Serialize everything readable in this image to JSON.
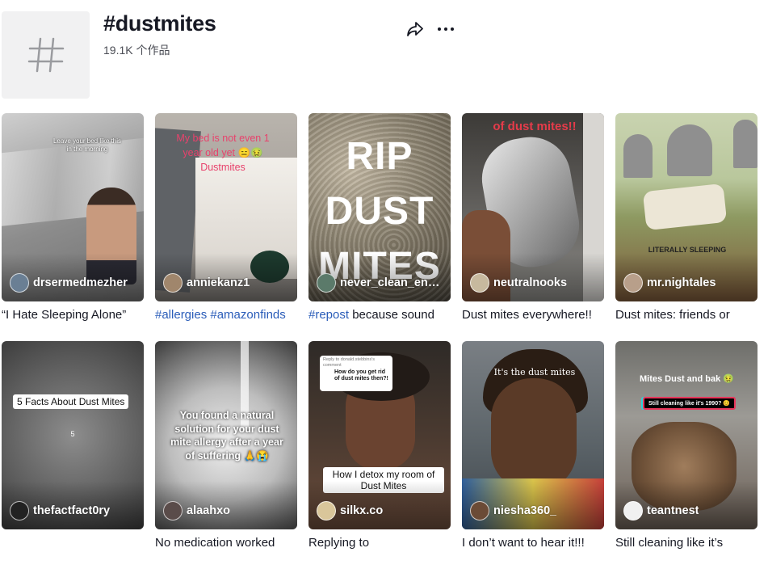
{
  "hashtag": {
    "title": "#dustmites",
    "count": "19.1K 个作品",
    "icon": "hashtag-icon"
  },
  "actions": {
    "share_icon": "share-icon",
    "more_icon": "more-icon"
  },
  "videos": [
    {
      "author": "drsermedmezher",
      "caption": "“I Hate Sleeping Alone”",
      "overlay": "Leave your bed like this in the morning"
    },
    {
      "author": "anniekanz1",
      "caption_tags": "#allergies #amazonfinds",
      "overlay": "My bed is not even 1 year old yet 😑🤢 Dustmites"
    },
    {
      "author": "never_clean_enou...",
      "caption_tag": "#repost",
      "caption_rest": " because sound",
      "overlay": "RIP DUST MITES"
    },
    {
      "author": "neutralnooks",
      "caption": "Dust mites everywhere!!",
      "overlay": "of dust mites!!"
    },
    {
      "author": "mr.nightales",
      "caption": "Dust mites: friends or",
      "overlay": "LITERALLY SLEEPING"
    },
    {
      "author": "thefactfact0ry",
      "caption": "",
      "overlay": "5 Facts About Dust Mites",
      "overlay2": "5"
    },
    {
      "author": "alaahxo",
      "caption": "No medication worked",
      "overlay": "You found a natural solution for your dust mite allergy after a year of suffering 🙏😭"
    },
    {
      "author": "silkx.co",
      "caption": "Replying to",
      "overlay": "How do you get rid of dust mites then?!",
      "overlay2": "How I detox my room of Dust Mites",
      "overlay3": "Reply to donald.stebbins's comment"
    },
    {
      "author": "niesha360_",
      "caption": "I don’t want to hear it!!!",
      "overlay": "It's the dust mites"
    },
    {
      "author": "teantnest",
      "caption": "Still cleaning like it’s",
      "overlay": "Mites Dust and bak 🤢",
      "overlay2": "Still cleaning like it's 1990? 😊"
    }
  ]
}
